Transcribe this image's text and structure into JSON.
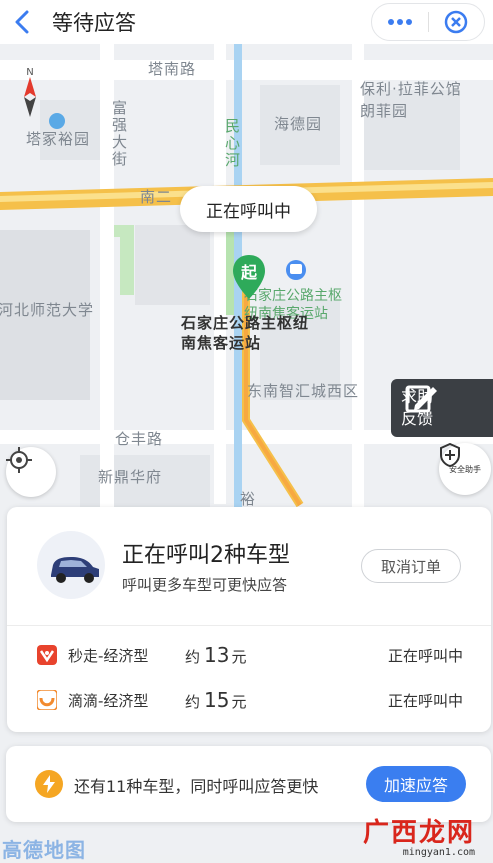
{
  "header": {
    "title": "等待应答"
  },
  "map": {
    "labels": {
      "tananlu": "塔南路",
      "tajiayuyuan": "塔冢裕园",
      "fuqiangdajie": "富强大街",
      "minxinhe": "民心河",
      "haideyuan": "海德园",
      "baoli": "保利·拉菲公馆朗菲园",
      "nanerhuan": "南二",
      "hebeishida": "河北师范大学",
      "busstop": "石家庄公路主枢纽南焦客运站",
      "pickup_line1": "石家庄公路主枢纽",
      "pickup_line2": "南焦客运站",
      "dongnanzhihui": "东南智汇城西区",
      "cangfenglu": "仓丰路",
      "xindinghuafu": "新鼎华府",
      "yu": "裕"
    },
    "calling_bubble": "正在呼叫中",
    "start_pin": "起"
  },
  "help_button": {
    "line1": "求助",
    "line2": "反馈"
  },
  "safety": {
    "label": "安全助手"
  },
  "card": {
    "title": "正在呼叫2种车型",
    "subtitle": "呼叫更多车型可更快应答",
    "cancel_label": "取消订单",
    "rows": [
      {
        "name": "秒走-经济型",
        "approx": "约",
        "price": "13",
        "unit": "元",
        "status": "正在呼叫中",
        "logo_color": "#e8432d"
      },
      {
        "name": "滴滴-经济型",
        "approx": "约",
        "price": "15",
        "unit": "元",
        "status": "正在呼叫中",
        "logo_color": "#f28a2e"
      }
    ]
  },
  "more": {
    "text": "还有11种车型，同时呼叫应答更快",
    "button": "加速应答"
  },
  "footer": {
    "amap_logo": "高德地图",
    "watermark_big": "广西龙网",
    "watermark_small": "mingyan1.com"
  },
  "colors": {
    "accent": "#3a7ef0",
    "route": "#f5c04a",
    "pin": "#2eaa5a"
  }
}
